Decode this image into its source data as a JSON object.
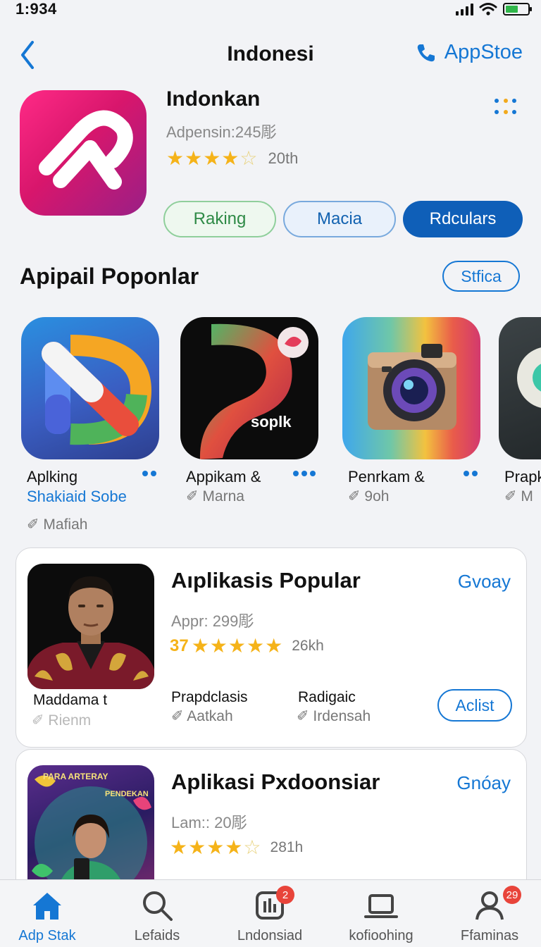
{
  "status_bar": {
    "time": "1:934"
  },
  "nav": {
    "title": "Indonesi",
    "store_label": "AppStoe"
  },
  "header_app": {
    "name": "Indonkan",
    "subtitle": "Adpensin:245彫",
    "stars": "★★★★",
    "stars_half": "☆",
    "rating_count": "20th",
    "chips": [
      "Raking",
      "Macia",
      "Rdculars"
    ]
  },
  "section": {
    "title": "Apipail Poponlar",
    "action": "Stfica",
    "apps": [
      {
        "name": "Aplking",
        "link": "Shakiaid Sobe",
        "meta": "✐ Mafiah"
      },
      {
        "name": "Appikam &",
        "logo_text": "soplk",
        "meta": "✐ Marna"
      },
      {
        "name": "Penrkam &",
        "meta": "✐ 9oh"
      },
      {
        "name": "Prapk",
        "meta": "✐ M"
      }
    ]
  },
  "cards": [
    {
      "title": "Aıplikasis Popular",
      "get_label": "Gvoay",
      "subtitle": "Appr: 299彫",
      "rating_num": "37",
      "stars": "★★★★★",
      "rating_count": "26kh",
      "caption_name": "Maddama t",
      "caption_meta": "✐ Rienm",
      "col1_label": "Prapdclasis",
      "col1_meta": "✐ Aatkah",
      "col2_label": "Radigaic",
      "col2_meta": "✐ Irdensah",
      "pill": "Aclist"
    },
    {
      "title": "Aplikasi Pxdoonsiar",
      "get_label": "Gnóay",
      "subtitle": "Lam:: 20彫",
      "stars": "★★★★",
      "stars_half": "☆",
      "rating_count": "281h",
      "poster_text_1": "PARA ARTERAY",
      "poster_text_2": "PENDEKAN"
    }
  ],
  "tabs": [
    {
      "label": "Adp Stak",
      "icon": "home-icon",
      "active": true
    },
    {
      "label": "Lefaids",
      "icon": "search-icon"
    },
    {
      "label": "Lndonsiad",
      "icon": "apps-icon",
      "badge": "2"
    },
    {
      "label": "kofioohing",
      "icon": "laptop-icon"
    },
    {
      "label": "Ffaminas",
      "icon": "profile-icon",
      "badge": "29"
    }
  ],
  "colors": {
    "accent": "#1577d4",
    "star": "#f5b319",
    "badge": "#e8443a"
  }
}
